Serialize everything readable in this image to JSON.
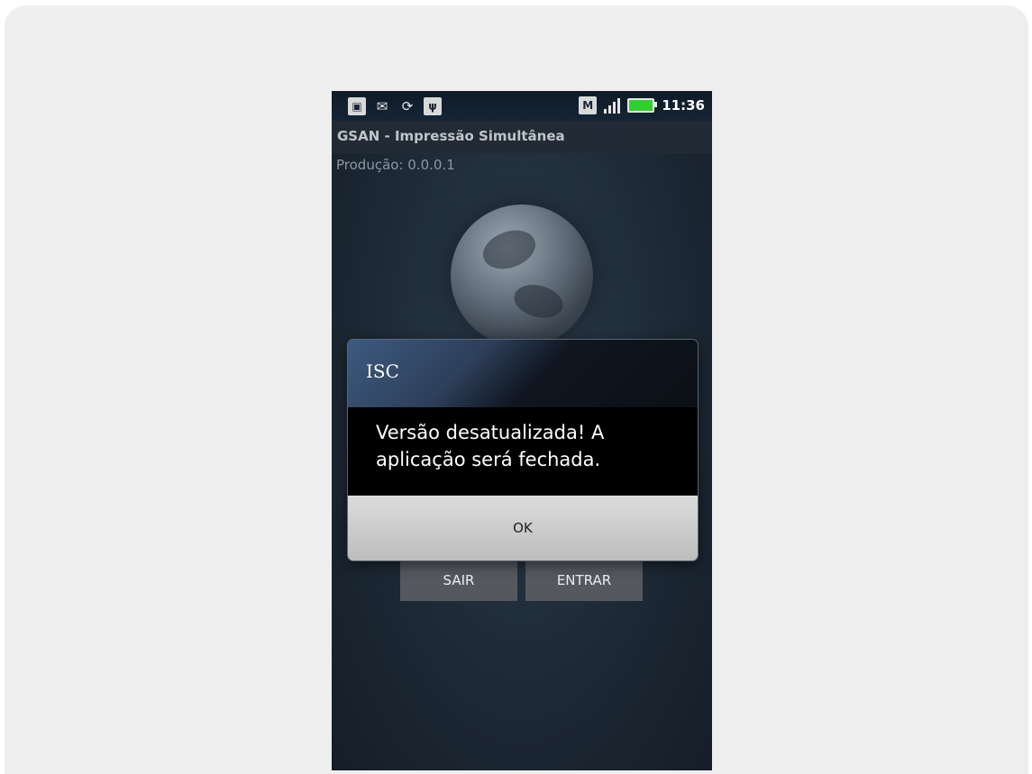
{
  "status_bar": {
    "icons": [
      "picture-icon",
      "mail-icon",
      "sync-icon",
      "usb-icon"
    ],
    "right_icons": [
      "m-icon",
      "signal-icon",
      "battery-icon"
    ],
    "time": "11:36"
  },
  "app": {
    "title": "GSAN - Impressão Simultânea",
    "version": "Produção: 0.0.0.1"
  },
  "background_buttons": {
    "exit_label": "SAIR",
    "enter_label": "ENTRAR"
  },
  "dialog": {
    "title": "ISC",
    "message": "Versão desatualizada! A aplicação será fechada.",
    "ok_label": "OK"
  },
  "colors": {
    "phone_background": "#1d2a38",
    "dialog_body": "#000000",
    "battery": "#2ed12b"
  }
}
